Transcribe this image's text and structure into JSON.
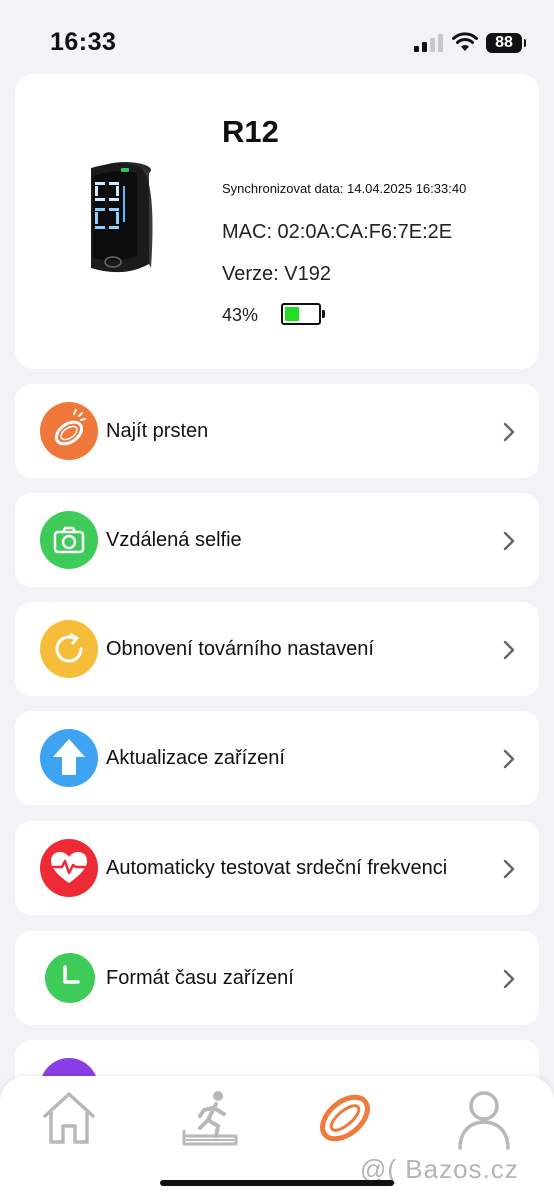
{
  "status_bar": {
    "time": "16:33",
    "battery": "88"
  },
  "device": {
    "name": "R12",
    "sync": "Synchronizovat data: 14.04.2025 16:33:40",
    "mac": "MAC: 02:0A:CA:F6:7E:2E",
    "version": "Verze: V192",
    "battery_percent": "43%",
    "battery_level": 0.43,
    "battery_color": "#22dd22"
  },
  "menu": [
    {
      "label": "Najít prsten",
      "icon": "ring-search-icon",
      "color": "#f0773a"
    },
    {
      "label": "Vzdálená selfie",
      "icon": "camera-icon",
      "color": "#3fcb5a"
    },
    {
      "label": "Obnovení továrního nastavení",
      "icon": "refresh-icon",
      "color": "#f5bd3a"
    },
    {
      "label": "Aktualizace zařízení",
      "icon": "upload-arrow-icon",
      "color": "#3ea3f2"
    },
    {
      "label": "Automaticky testovat srdeční frekvenci",
      "icon": "heart-rate-icon",
      "color": "#ee2a35"
    },
    {
      "label": "Formát času zařízení",
      "icon": "clock-icon",
      "color": "#3fcb5a"
    }
  ],
  "tab_bar": {
    "tabs": [
      "home-icon",
      "treadmill-icon",
      "ring-icon",
      "profile-icon"
    ],
    "active_color": "#f07a3a"
  },
  "watermark": "@( Bazos.cz"
}
